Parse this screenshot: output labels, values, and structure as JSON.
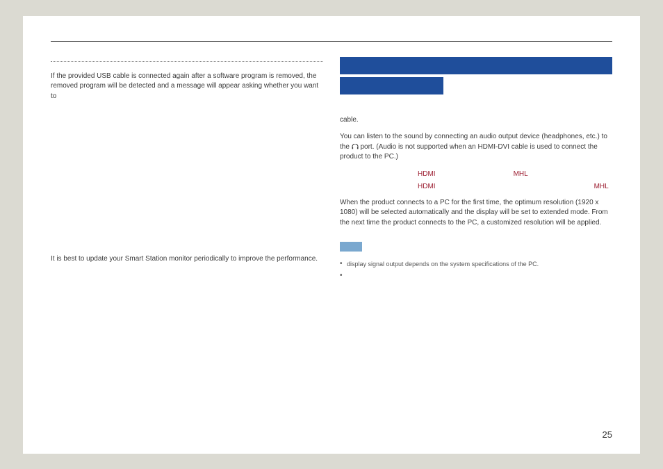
{
  "left": {
    "p1": "If the provided USB cable is connected again after a software program is removed, the removed program will be detected and a message will appear asking whether you want to",
    "p2": "It is best to update your Smart Station monitor periodically to improve the performance."
  },
  "right": {
    "p_cable": "cable.",
    "p_audio_a": "You can listen to the sound by connecting an audio output device (headphones, etc.) to the ",
    "p_audio_b": " port. (Audio is not supported when an HDMI-DVI cable is used to connect the product to the PC.)",
    "enum1a": "HDMI",
    "enum1b": "MHL",
    "enum2a": "HDMI",
    "enum2b": "MHL",
    "p_res": "When the product connects to a PC for the first time, the optimum resolution (1920 x 1080) will be selected automatically and the display will be set to extended mode. From the next time the product connects to the PC, a customized resolution will be applied.",
    "note1": "display signal output depends on the system specifications of the PC.",
    "note2": ""
  },
  "page_number": "25"
}
